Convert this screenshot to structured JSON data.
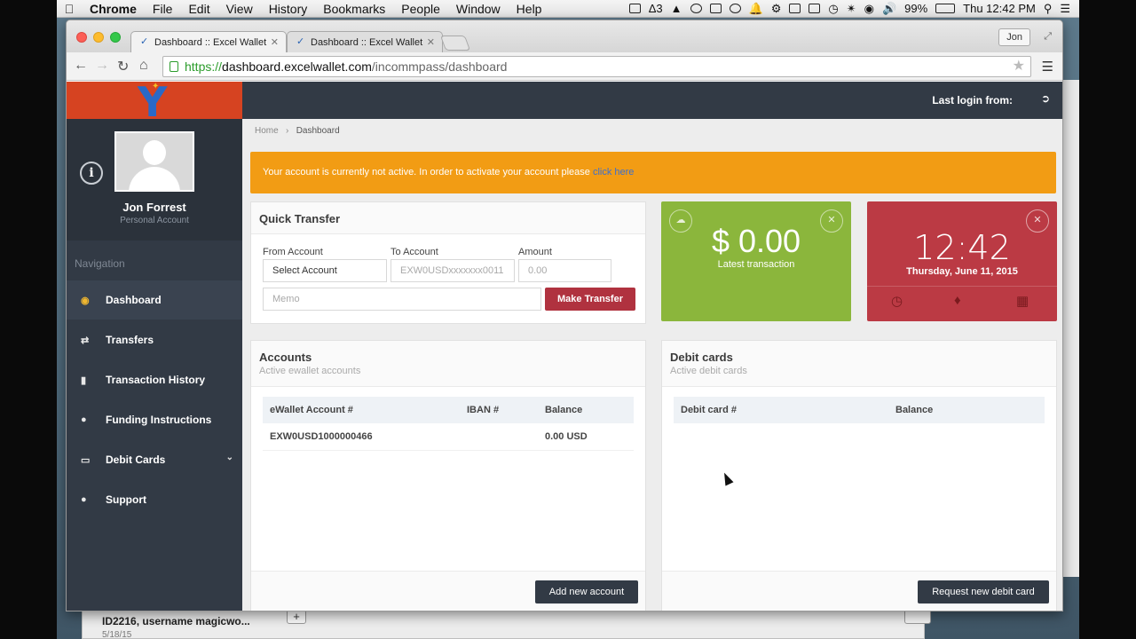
{
  "menubar": {
    "app": "Chrome",
    "items": [
      "File",
      "Edit",
      "View",
      "History",
      "Bookmarks",
      "People",
      "Window",
      "Help"
    ],
    "badge_count": "3",
    "battery": "99%",
    "clock": "Thu 12:42 PM"
  },
  "browser": {
    "tabs": [
      {
        "title": "Dashboard :: Excel Wallet",
        "active": true
      },
      {
        "title": "Dashboard :: Excel Wallet",
        "active": false
      }
    ],
    "profile_name": "Jon",
    "url_scheme": "https://",
    "url_host": "dashboard.excelwallet.com",
    "url_path": "/incommpass/dashboard"
  },
  "sidebar": {
    "user_name": "Jon Forrest",
    "user_type": "Personal Account",
    "nav_heading": "Navigation",
    "items": [
      {
        "label": "Dashboard",
        "icon": "dashboard-icon"
      },
      {
        "label": "Transfers",
        "icon": "transfer-icon"
      },
      {
        "label": "Transaction History",
        "icon": "book-icon"
      },
      {
        "label": "Funding Instructions",
        "icon": "info-icon"
      },
      {
        "label": "Debit Cards",
        "icon": "credit-card-icon"
      },
      {
        "label": "Support",
        "icon": "chat-icon"
      }
    ]
  },
  "topbar": {
    "last_login": "Last login from:"
  },
  "breadcrumb": {
    "home": "Home",
    "current": "Dashboard"
  },
  "alert": {
    "text": "Your account is currently not active. In order to activate your account please ",
    "link": "click here"
  },
  "quick_transfer": {
    "title": "Quick Transfer",
    "from_label": "From Account",
    "from_value": "Select Account",
    "to_label": "To Account",
    "to_placeholder": "EXW0USDxxxxxxx0011",
    "amount_label": "Amount",
    "amount_placeholder": "0.00",
    "memo_placeholder": "Memo",
    "submit": "Make Transfer"
  },
  "latest_widget": {
    "amount": "$ 0.00",
    "label": "Latest transaction"
  },
  "clock_widget": {
    "time": "12:42",
    "date": "Thursday, June 11, 2015"
  },
  "accounts": {
    "title": "Accounts",
    "subtitle": "Active ewallet accounts",
    "columns": [
      "eWallet Account #",
      "IBAN #",
      "Balance"
    ],
    "rows": [
      {
        "account": "EXW0USD1000000466",
        "iban": "",
        "balance": "0.00 USD"
      }
    ],
    "button": "Add new account"
  },
  "debit_cards": {
    "title": "Debit cards",
    "subtitle": "Active debit cards",
    "columns": [
      "Debit card #",
      "Balance"
    ],
    "button": "Request new debit card"
  },
  "background_window": {
    "item_title": "ID2216, username magicwo...",
    "item_date": "5/18/15"
  },
  "colors": {
    "sidebar": "#323a45",
    "alert": "#f29c14",
    "green_widget": "#8bb63c",
    "red_widget": "#bb3a44",
    "primary_button": "#b0323f"
  }
}
